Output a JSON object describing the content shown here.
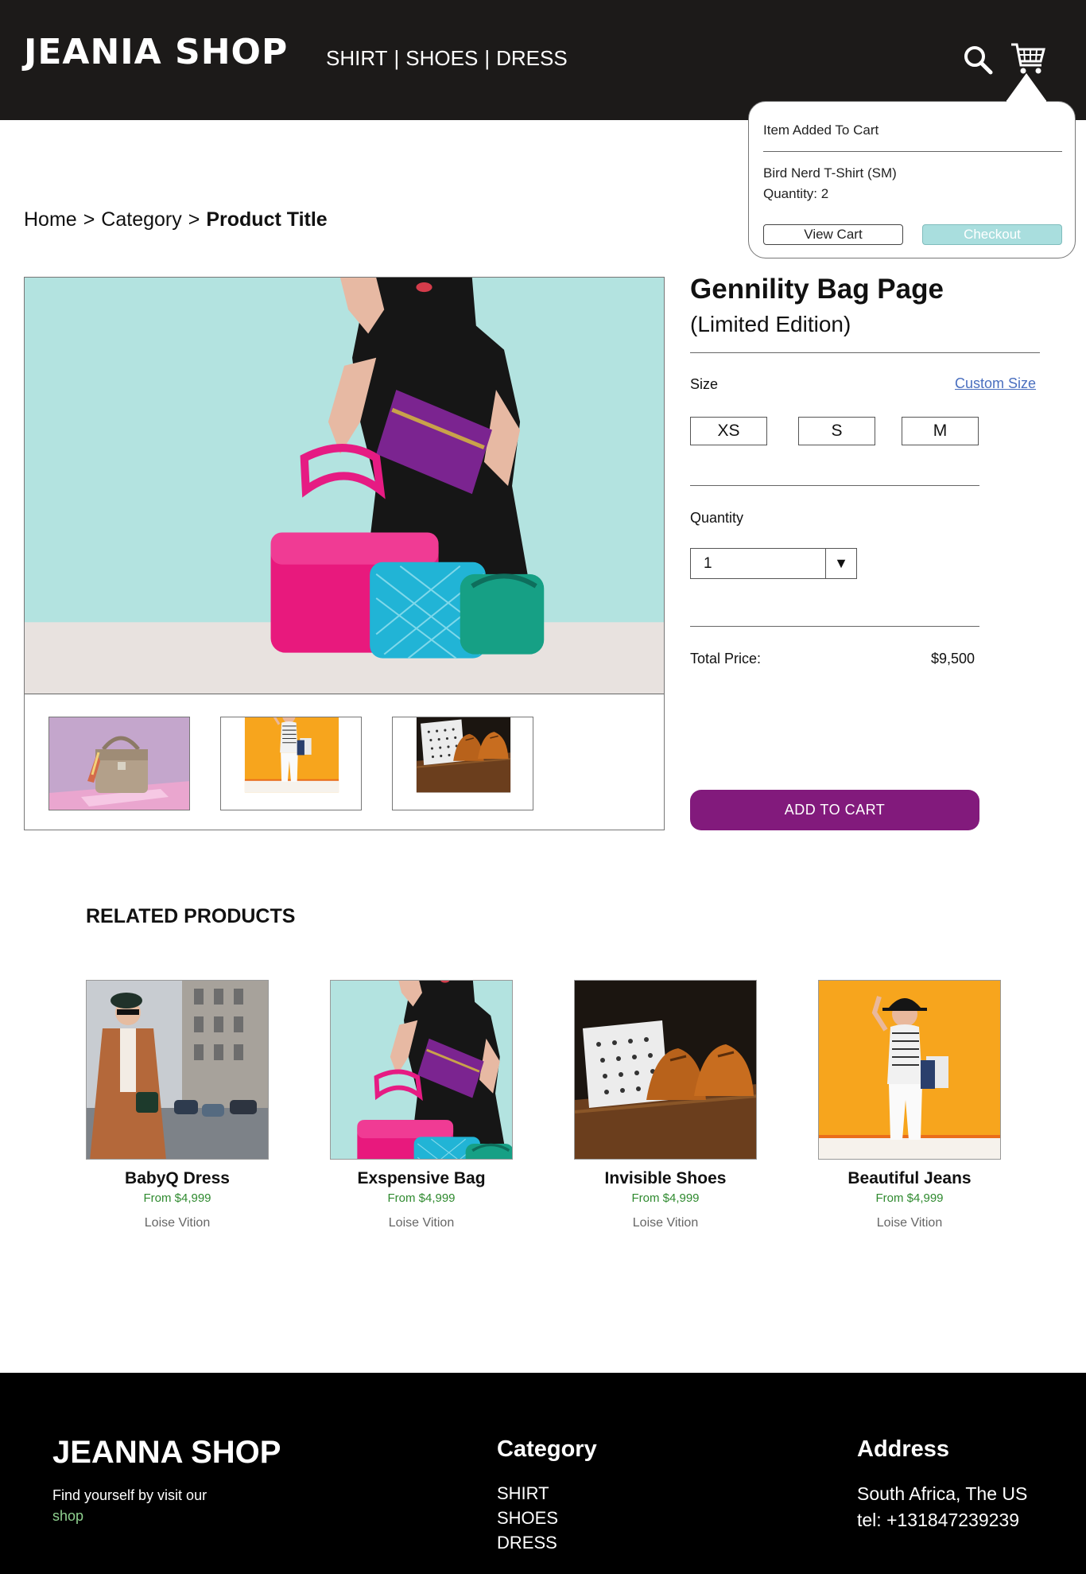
{
  "header": {
    "logo": "JEANIA SHOP",
    "nav": [
      "SHIRT",
      "|",
      "SHOES",
      "|",
      "DRESS"
    ],
    "search_icon": "search-icon",
    "cart_icon": "cart-icon",
    "bg_color": "#1c1a19"
  },
  "cart_popup": {
    "title": "Item Added To Cart",
    "item": "Bird Nerd T-Shirt (SM)",
    "quantity": "Quantity: 2",
    "view_cart_label": "View Cart",
    "checkout_label": "Checkout"
  },
  "breadcrumb": {
    "home": "Home",
    "sep": ">",
    "category": "Category",
    "current": "Product Title"
  },
  "product": {
    "title": "Gennility Bag Page",
    "subtitle": "(Limited Edition)",
    "size_label": "Size",
    "custom_size": "Custom Size",
    "sizes": [
      "XS",
      "S",
      "M"
    ],
    "quantity_label": "Quantity",
    "quantity_value": "1",
    "total_label": "Total Price:",
    "total_value": "$9,500",
    "add_to_cart": "ADD TO CART",
    "accent_color": "#821a7c"
  },
  "related": {
    "title": "RELATED PRODUCTS",
    "items": [
      {
        "name": "BabyQ Dress",
        "price": "From $4,999",
        "brand": "Loise Vition"
      },
      {
        "name": "Exspensive Bag",
        "price": "From $4,999",
        "brand": "Loise Vition"
      },
      {
        "name": "Invisible Shoes",
        "price": "From $4,999",
        "brand": "Loise Vition"
      },
      {
        "name": "Beautiful Jeans",
        "price": "From $4,999",
        "brand": "Loise Vition"
      }
    ]
  },
  "footer": {
    "logo": "JEANNA SHOP",
    "tagline": "Find yourself by visit our",
    "shop_link": "shop",
    "category_title": "Category",
    "categories": [
      "SHIRT",
      "SHOES",
      "DRESS"
    ],
    "address_title": "Address",
    "address": "South Africa, The US",
    "tel": "tel: +131847239239"
  }
}
